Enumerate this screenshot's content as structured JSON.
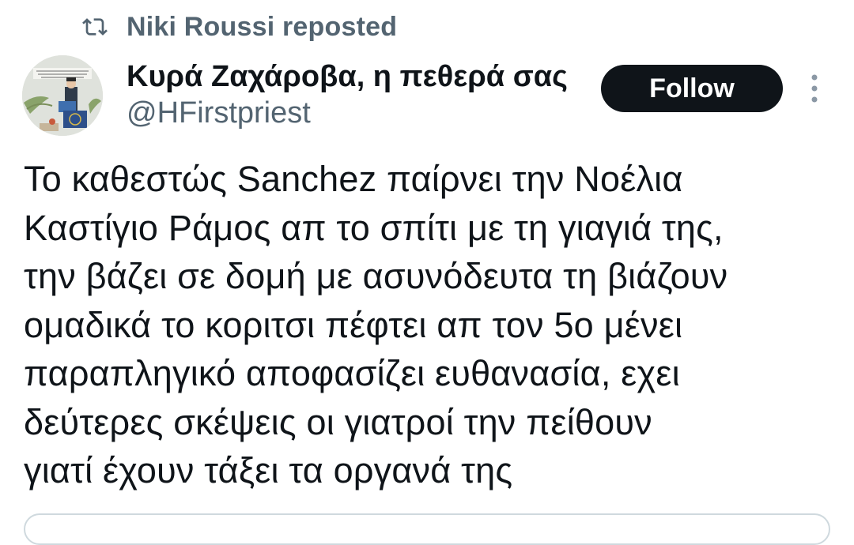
{
  "repost": {
    "icon": "repost-icon",
    "text": "Niki Roussi reposted"
  },
  "author": {
    "avatar_icon": "avatar-cartoon-image",
    "display_name": "Κυρά Ζαχάροβα, η πεθερά σας",
    "handle": "@HFirstpriest"
  },
  "actions": {
    "follow_label": "Follow",
    "more_icon": "more-vertical-icon"
  },
  "tweet": {
    "lines": [
      "Το καθεστώς Sanchez παίρνει την Νοέλια",
      "Καστίγιο Ράμος απ το σπίτι με τη γιαγιά της,",
      "την βάζει σε δομή με ασυνόδευτα τη βιάζουν",
      "ομαδικά το κοριτσι πέφτει απ τον 5ο μένει",
      "παραπληγικό αποφασίζει ευθανασία, εχει",
      "δεύτερες σκέψεις οι γιατροί την πείθουν",
      "γιατί έχουν τάξει τα οργανά της"
    ]
  },
  "colors": {
    "text_primary": "#0f1419",
    "text_secondary": "#536471",
    "follow_bg": "#0f1419",
    "follow_text": "#ffffff",
    "border": "#cfd9de"
  }
}
